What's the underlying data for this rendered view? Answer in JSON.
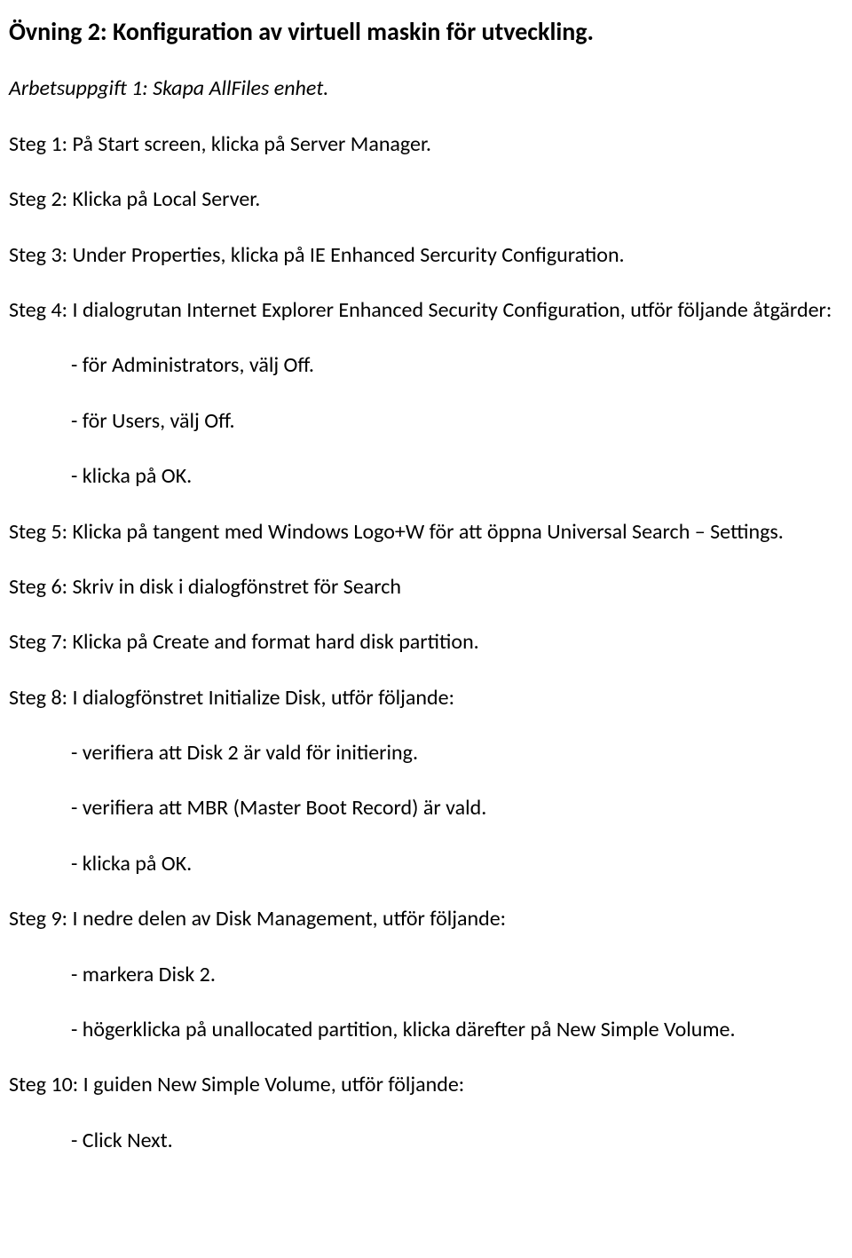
{
  "title": "Övning 2: Konfiguration av virtuell maskin för utveckling.",
  "task": "Arbetsuppgift 1: Skapa AllFiles enhet.",
  "step1": "Steg 1: På Start screen, klicka på Server Manager.",
  "step2": "Steg 2: Klicka på Local Server.",
  "step3": "Steg 3:  Under Properties, klicka på IE Enhanced Sercurity Configuration.",
  "step4": "Steg 4: I dialogrutan Internet Explorer Enhanced Security Configuration, utför följande åtgärder:",
  "step4_a": "- för Administrators, välj Off.",
  "step4_b": "- för Users, välj Off.",
  "step4_c": "- klicka på OK.",
  "step5": "Steg 5: Klicka på tangent med Windows Logo+W för att öppna Universal Search – Settings.",
  "step6": "Steg 6: Skriv in disk i dialogfönstret för Search",
  "step7": "Steg 7: Klicka på Create and format hard disk partition.",
  "step8": "Steg 8: I dialogfönstret Initialize Disk, utför följande:",
  "step8_a": "- verifiera att Disk 2 är vald för initiering.",
  "step8_b": "- verifiera att MBR (Master Boot Record) är vald.",
  "step8_c": "- klicka på OK.",
  "step9": "Steg 9: I nedre delen av Disk Management, utför följande:",
  "step9_a": "- markera Disk 2.",
  "step9_b": "- högerklicka på unallocated partition, klicka därefter på New Simple Volume.",
  "step10": "Steg 10: I guiden New Simple Volume, utför följande:",
  "step10_a": "- Click Next."
}
